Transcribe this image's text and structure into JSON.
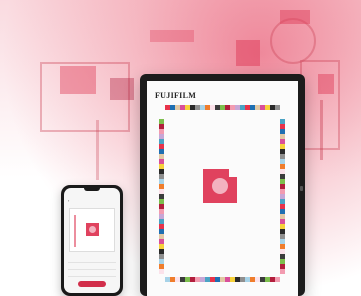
{
  "brand": {
    "name": "FUJIFILM",
    "accent_color": "#e0425e"
  },
  "tablet": {
    "header_title": "",
    "header_page": "",
    "footer_text": "",
    "swatch_colors": [
      "#e8334a",
      "#f29bb0",
      "#3c3c3c",
      "#a7d3e8",
      "#f6d13a",
      "#1f6fb2",
      "#c7a6d6",
      "#7dbf4e",
      "#ef7d2c",
      "#2a2a2a",
      "#e1c8a4",
      "#4aa3c4",
      "#b21e3c",
      "#fbe2ea",
      "#8f8f8f",
      "#d94f9a"
    ]
  },
  "phone": {
    "back_icon": "chevron-left-icon",
    "title": "",
    "rows": [
      {
        "label": "",
        "value": ""
      },
      {
        "label": "",
        "value": ""
      },
      {
        "label": "",
        "value": ""
      }
    ],
    "action_label": ""
  }
}
